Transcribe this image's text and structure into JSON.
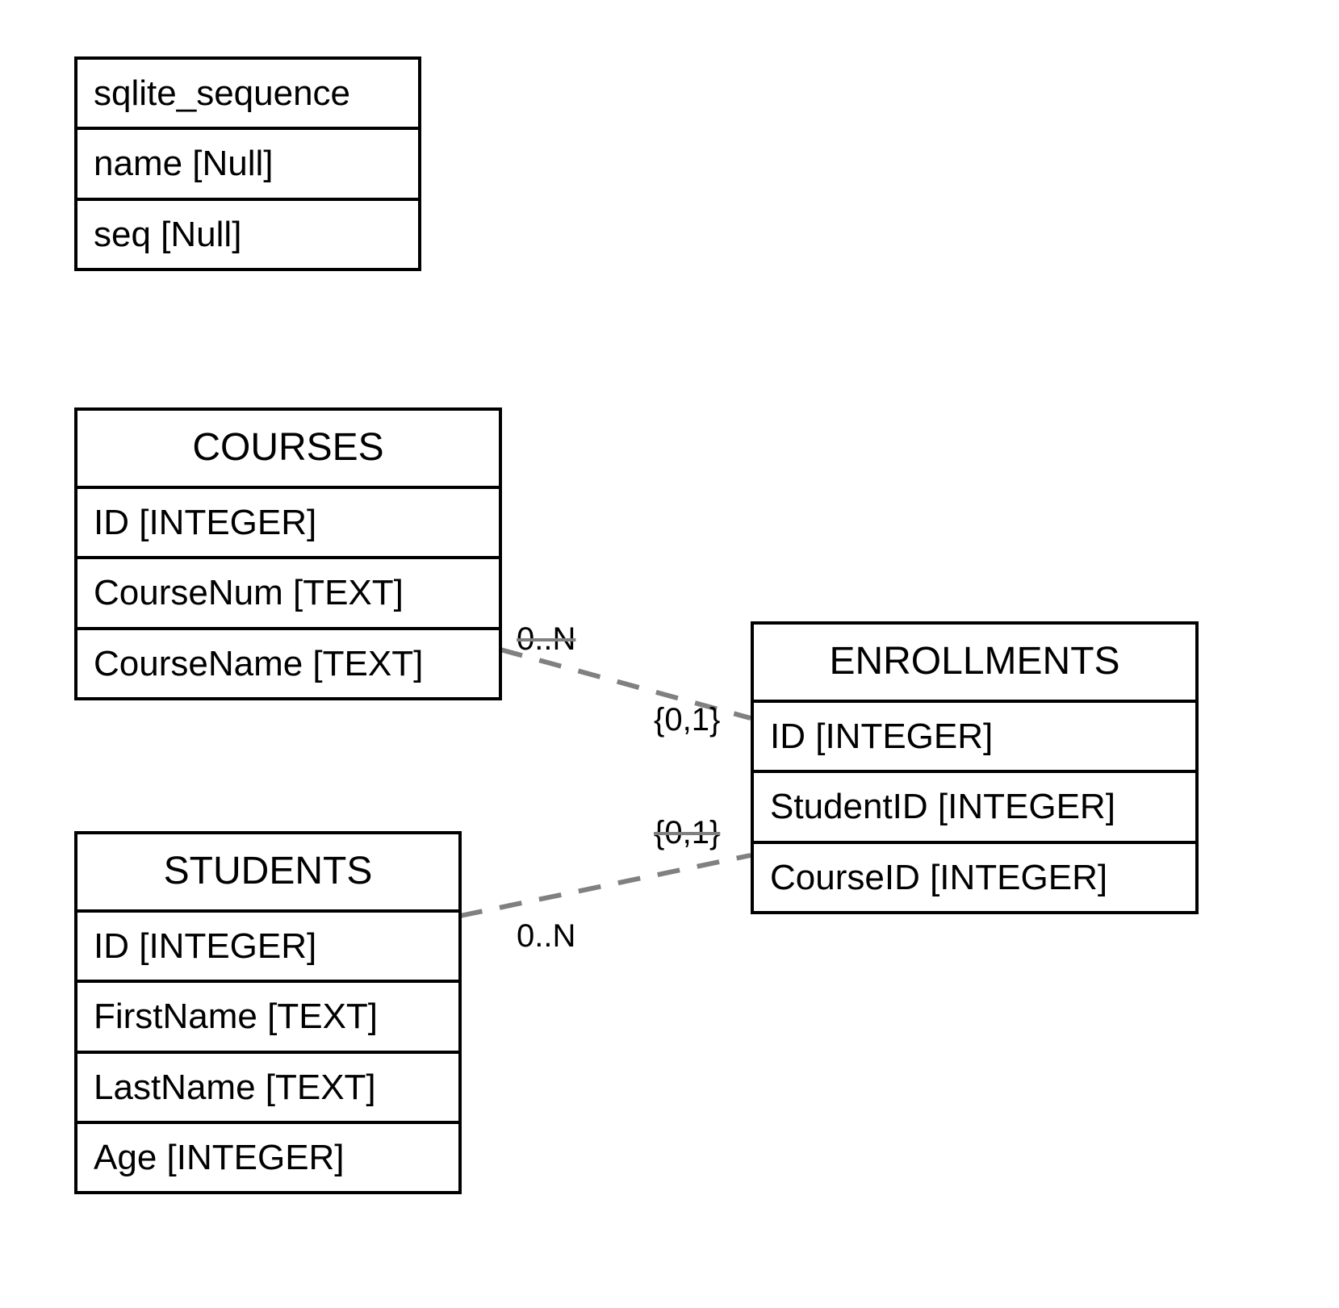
{
  "entities": {
    "sqlite_sequence": {
      "title": "sqlite_sequence",
      "fields": [
        "name [Null]",
        "seq [Null]"
      ]
    },
    "courses": {
      "title": "COURSES",
      "fields": [
        "ID [INTEGER]",
        "CourseNum [TEXT]",
        "CourseName [TEXT]"
      ]
    },
    "students": {
      "title": "STUDENTS",
      "fields": [
        "ID [INTEGER]",
        "FirstName [TEXT]",
        "LastName [TEXT]",
        "Age [INTEGER]"
      ]
    },
    "enrollments": {
      "title": "ENROLLMENTS",
      "fields": [
        "ID [INTEGER]",
        "StudentID [INTEGER]",
        "CourseID [INTEGER]"
      ]
    }
  },
  "relations": {
    "courses_enrollments": {
      "left_card": "0..N",
      "right_card": "{0,1}"
    },
    "students_enrollments": {
      "left_card": "0..N",
      "right_card": "{0,1}"
    }
  }
}
